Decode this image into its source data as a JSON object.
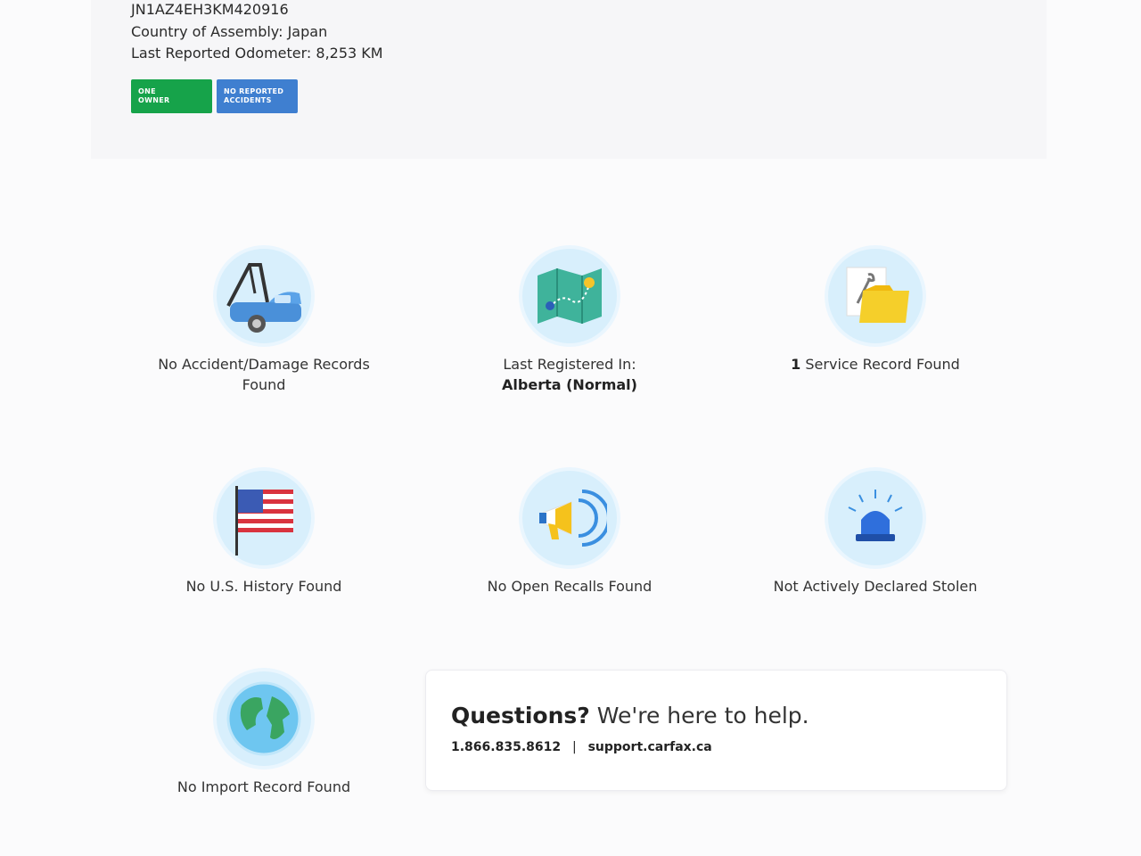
{
  "vehicle": {
    "vin": "JN1AZ4EH3KM420916",
    "country_of_assembly": "Country of Assembly: Japan",
    "odometer": "Last Reported Odometer: 8,253 KM"
  },
  "badges": {
    "owner": {
      "line1": "ONE",
      "line2": "OWNER",
      "color": "#16a34a"
    },
    "accidents": {
      "line1": "NO REPORTED",
      "line2": "ACCIDENTS",
      "color": "#3f7fd0"
    }
  },
  "features": {
    "accident": {
      "label1": "No Accident/Damage Records",
      "label2": "Found",
      "icon": "tow-truck-icon"
    },
    "registration": {
      "label1": "Last Registered In:",
      "label2": "Alberta (Normal)",
      "icon": "map-icon"
    },
    "service": {
      "count": "1",
      "label": "Service Record Found",
      "icon": "folder-wrench-icon"
    },
    "us_history": {
      "label": "No U.S. History Found",
      "icon": "us-flag-icon"
    },
    "recalls": {
      "label": "No Open Recalls Found",
      "icon": "megaphone-icon"
    },
    "stolen": {
      "label": "Not Actively Declared Stolen",
      "icon": "siren-icon"
    },
    "import": {
      "label": "No Import Record Found",
      "icon": "globe-icon"
    }
  },
  "help": {
    "title_bold": "Questions?",
    "title_rest": "We're here to help.",
    "phone": "1.866.835.8612",
    "separator": "|",
    "email": "support.carfax.ca"
  },
  "colors": {
    "icon_bg": "#d8effc",
    "green_badge": "#16a34a",
    "blue_badge": "#3f7fd0"
  }
}
